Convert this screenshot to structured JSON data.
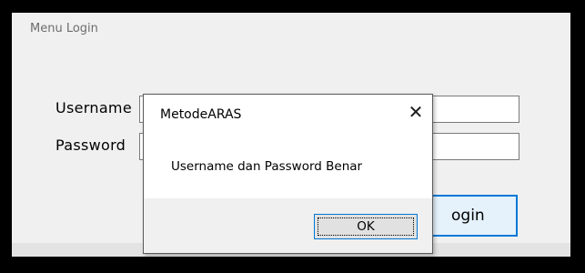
{
  "window": {
    "title": "Menu Login"
  },
  "form": {
    "username_label": "Username",
    "password_label": "Password",
    "username_value": "",
    "password_value": "",
    "login_button_label": "Login",
    "login_button_visible_text": "ogin"
  },
  "dialog": {
    "title": "MetodeARAS",
    "close_icon": "close-icon",
    "message": "Username dan Password Benar",
    "ok_label": "OK"
  },
  "colors": {
    "accent": "#0078d7",
    "window_bg": "#f0f0f0",
    "dialog_bg": "#ffffff",
    "frame": "#000000"
  }
}
